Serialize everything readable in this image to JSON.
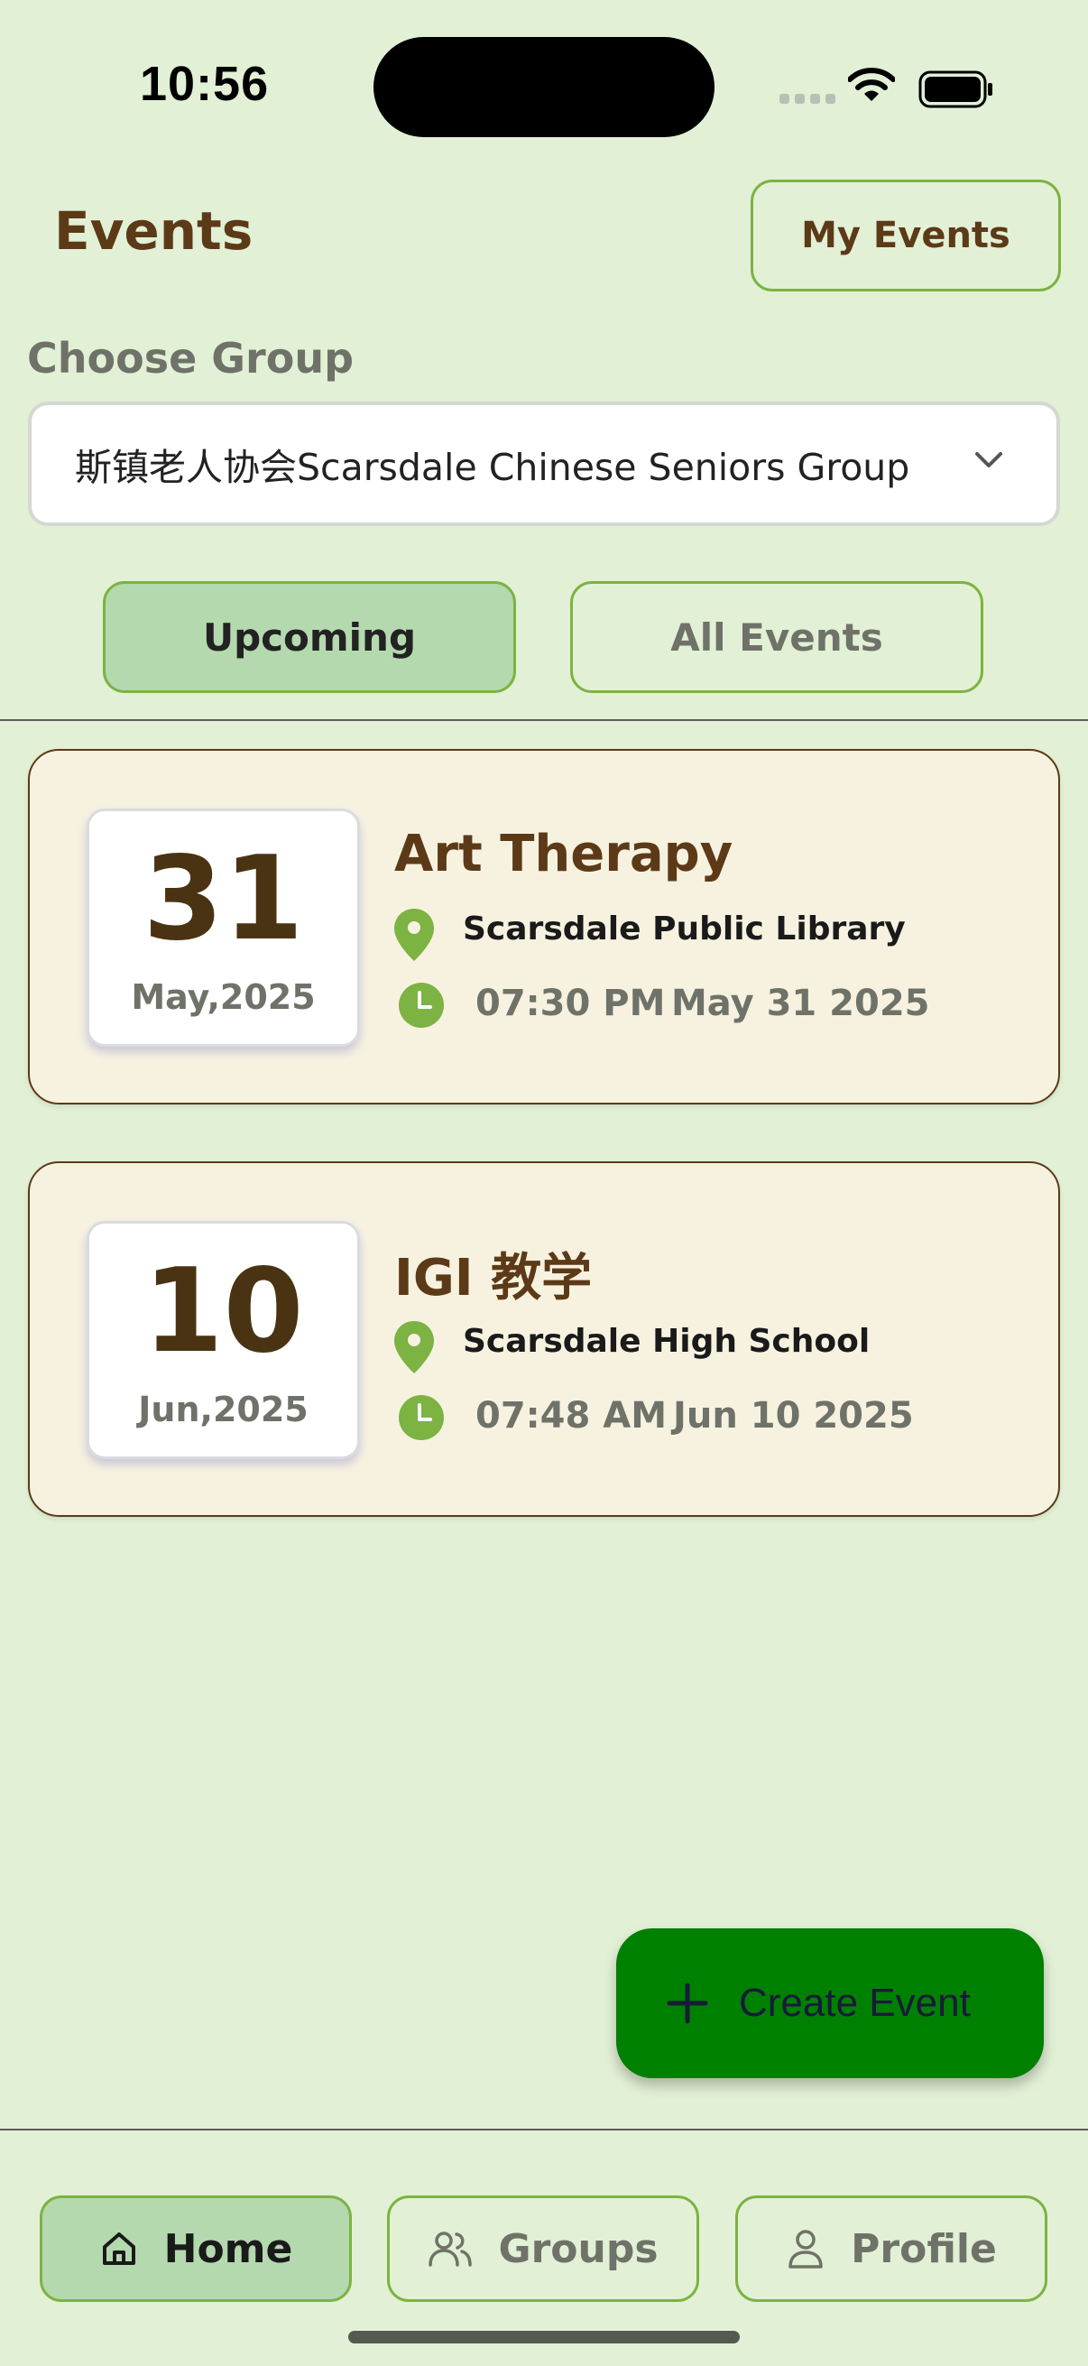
{
  "status_bar": {
    "time": "10:56"
  },
  "header": {
    "title": "Events",
    "my_events_label": "My Events"
  },
  "group_select": {
    "label": "Choose Group",
    "value": "斯镇老人协会Scarsdale Chinese Seniors Group"
  },
  "filters": {
    "upcoming_label": "Upcoming",
    "all_label": "All Events",
    "active": "Upcoming"
  },
  "events": [
    {
      "day": "31",
      "month_year": "May,2025",
      "title": "Art Therapy",
      "location": "Scarsdale Public Library",
      "time": "07:30 PM",
      "date": "May 31 2025"
    },
    {
      "day": "10",
      "month_year": "Jun,2025",
      "title": "IGI 教学",
      "location": "Scarsdale High School",
      "time": "07:48 AM",
      "date": "Jun 10 2025"
    }
  ],
  "fab": {
    "label": "Create Event",
    "icon": "plus-icon"
  },
  "nav": {
    "home_label": "Home",
    "groups_label": "Groups",
    "profile_label": "Profile",
    "active": "Home",
    "icons": [
      "home-icon",
      "users-icon",
      "user-icon"
    ]
  },
  "colors": {
    "accent_green": "#7cb342",
    "active_fill": "#b4d9af",
    "brown": "#5c3a18",
    "fab_green": "#008000",
    "background": "#e2f0d5"
  }
}
